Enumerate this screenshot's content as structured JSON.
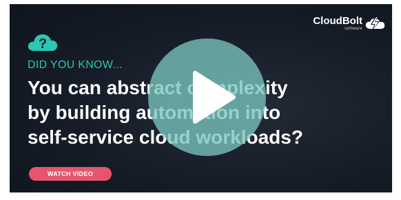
{
  "brand": {
    "name": "CloudBolt",
    "tagline": "software"
  },
  "content": {
    "eyebrow": "DID YOU KNOW...",
    "headline_lines": [
      "You can abstract complexity",
      "by building automation into",
      "self-service cloud workloads?"
    ],
    "cta_label": "WATCH VIDEO"
  },
  "icons": {
    "question": "question-cloud-icon",
    "play": "play-icon",
    "logo": "cloudbolt-logo-icon"
  },
  "colors": {
    "background": "#161c27",
    "accent": "#2cc7b4",
    "cta": "#e5566e",
    "play_overlay": "#7ac4be"
  }
}
